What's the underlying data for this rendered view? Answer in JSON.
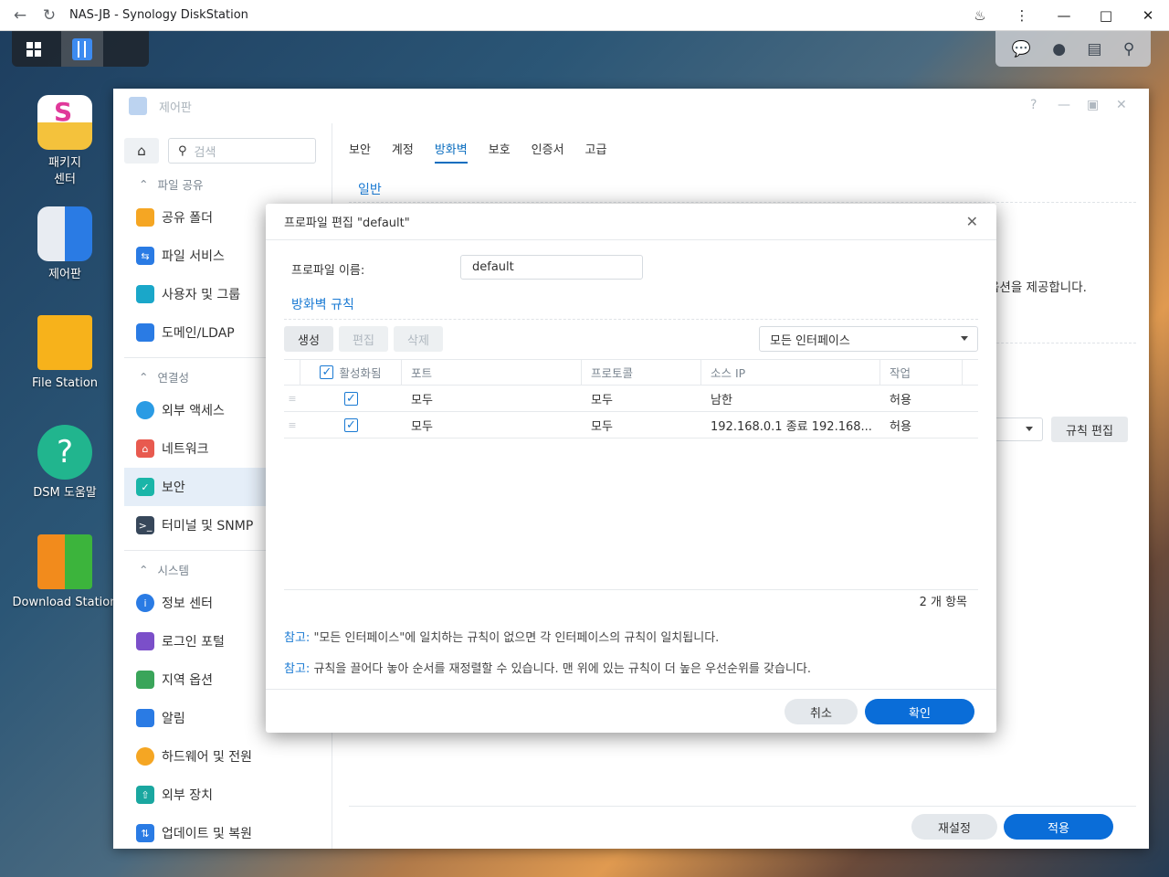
{
  "browser": {
    "title": "NAS-JB - Synology DiskStation"
  },
  "desktop": {
    "icons": [
      "패키지 센터",
      "제어판",
      "File Station",
      "DSM 도움말",
      "Download Station"
    ]
  },
  "window": {
    "title": "제어판"
  },
  "sidebar": {
    "search_placeholder": "검색",
    "sections": [
      "파일 공유",
      "연결성",
      "시스템"
    ],
    "items": [
      "공유 폴더",
      "파일 서비스",
      "사용자 및 그룹",
      "도메인/LDAP",
      "외부 액세스",
      "네트워크",
      "보안",
      "터미널 및 SNMP",
      "정보 센터",
      "로그인 포털",
      "지역 옵션",
      "알림",
      "하드웨어 및 전원",
      "외부 장치",
      "업데이트 및 복원"
    ]
  },
  "tabs": [
    "보안",
    "계정",
    "방화벽",
    "보호",
    "인증서",
    "고급"
  ],
  "main": {
    "subtitle": "일반",
    "fragment": "옵션을 제공합니다.",
    "rule_edit": "규칙 편집",
    "reset": "재설정",
    "apply": "적용"
  },
  "modal": {
    "title": "프로파일 편집 \"default\"",
    "name_label": "프로파일 이름:",
    "name_value": "default",
    "section": "방화벽 규칙",
    "buttons": {
      "create": "생성",
      "edit": "편집",
      "delete": "삭제"
    },
    "interface": "모든 인터페이스",
    "columns": [
      "활성화됨",
      "포트",
      "프로토콜",
      "소스 IP",
      "작업"
    ],
    "rows": [
      {
        "port": "모두",
        "protocol": "모두",
        "source": "남한",
        "action": "허용"
      },
      {
        "port": "모두",
        "protocol": "모두",
        "source": "192.168.0.1 종료 192.168...",
        "action": "허용"
      }
    ],
    "count": "2 개 항목",
    "note_label": "참고:",
    "note1": "\"모든 인터페이스\"에 일치하는 규칙이 없으면 각 인터페이스의 규칙이 일치됩니다.",
    "note2": "규칙을 끌어다 놓아 순서를 재정렬할 수 있습니다. 맨 위에 있는 규칙이 더 높은 우선순위를 갖습니다.",
    "cancel": "취소",
    "ok": "확인"
  }
}
